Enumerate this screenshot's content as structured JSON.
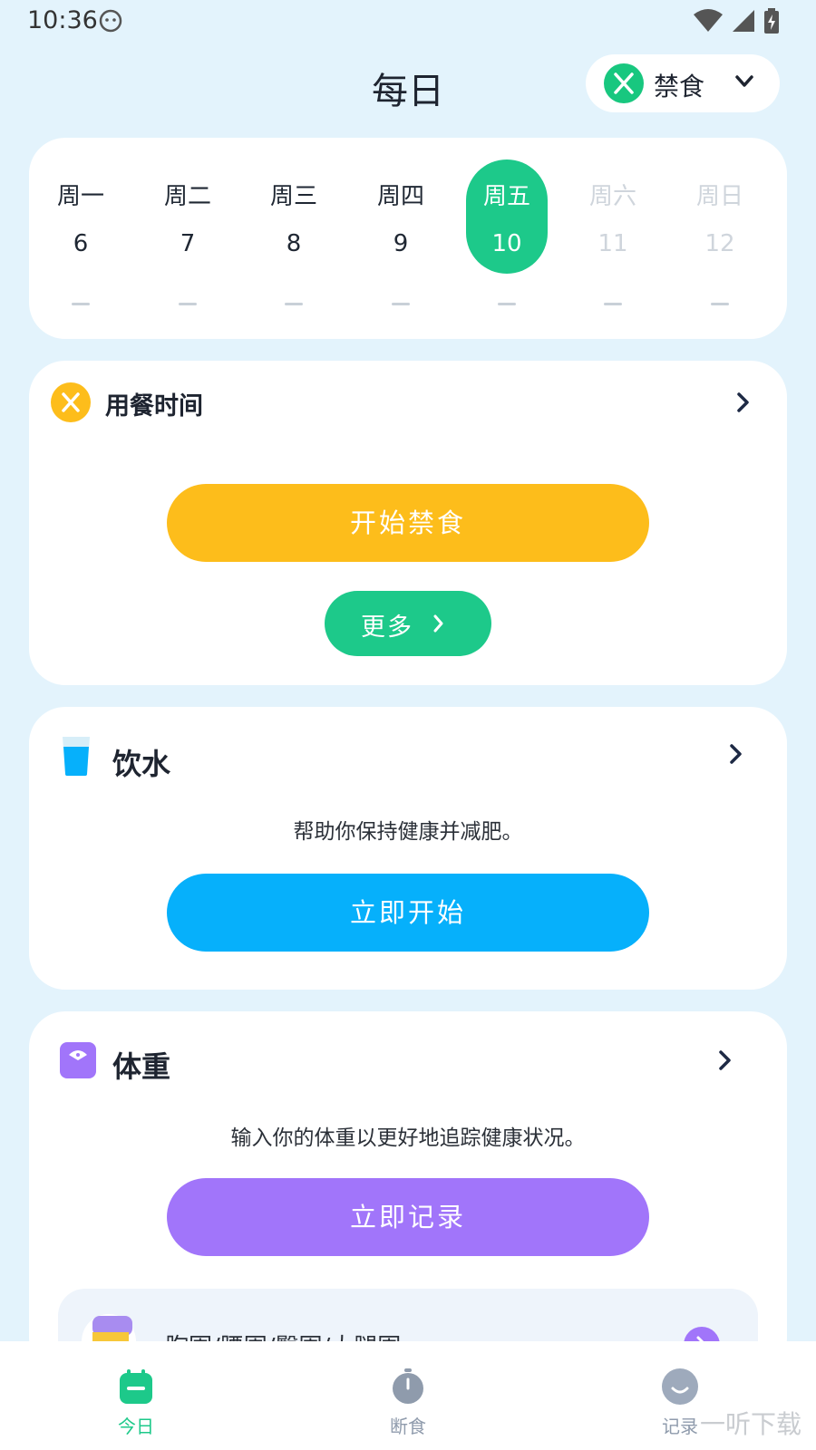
{
  "status": {
    "time": "10:36"
  },
  "header": {
    "title": "每日",
    "mode_label": "禁食"
  },
  "week": {
    "days": [
      {
        "name": "周一",
        "date": "6"
      },
      {
        "name": "周二",
        "date": "7"
      },
      {
        "name": "周三",
        "date": "8"
      },
      {
        "name": "周四",
        "date": "9"
      },
      {
        "name": "周五",
        "date": "10"
      },
      {
        "name": "周六",
        "date": "11"
      },
      {
        "name": "周日",
        "date": "12"
      }
    ],
    "selected": "周五"
  },
  "meal": {
    "title": "用餐时间",
    "start_label": "开始禁食",
    "more_label": "更多"
  },
  "water": {
    "title": "饮水",
    "desc": "帮助你保持健康并减肥。",
    "start_label": "立即开始"
  },
  "weight": {
    "title": "体重",
    "desc": "输入你的体重以更好地追踪健康状况。",
    "record_label": "立即记录",
    "measure_label": "胸围/腰围/臀围/大腿围"
  },
  "tabs": [
    {
      "label": "今日"
    },
    {
      "label": "断食"
    },
    {
      "label": "记录"
    }
  ],
  "watermark": "一听下载",
  "colors": {
    "green": "#1dc98a",
    "yellow": "#fdbd1b",
    "blue": "#06b0fb",
    "purple": "#a175fa"
  }
}
